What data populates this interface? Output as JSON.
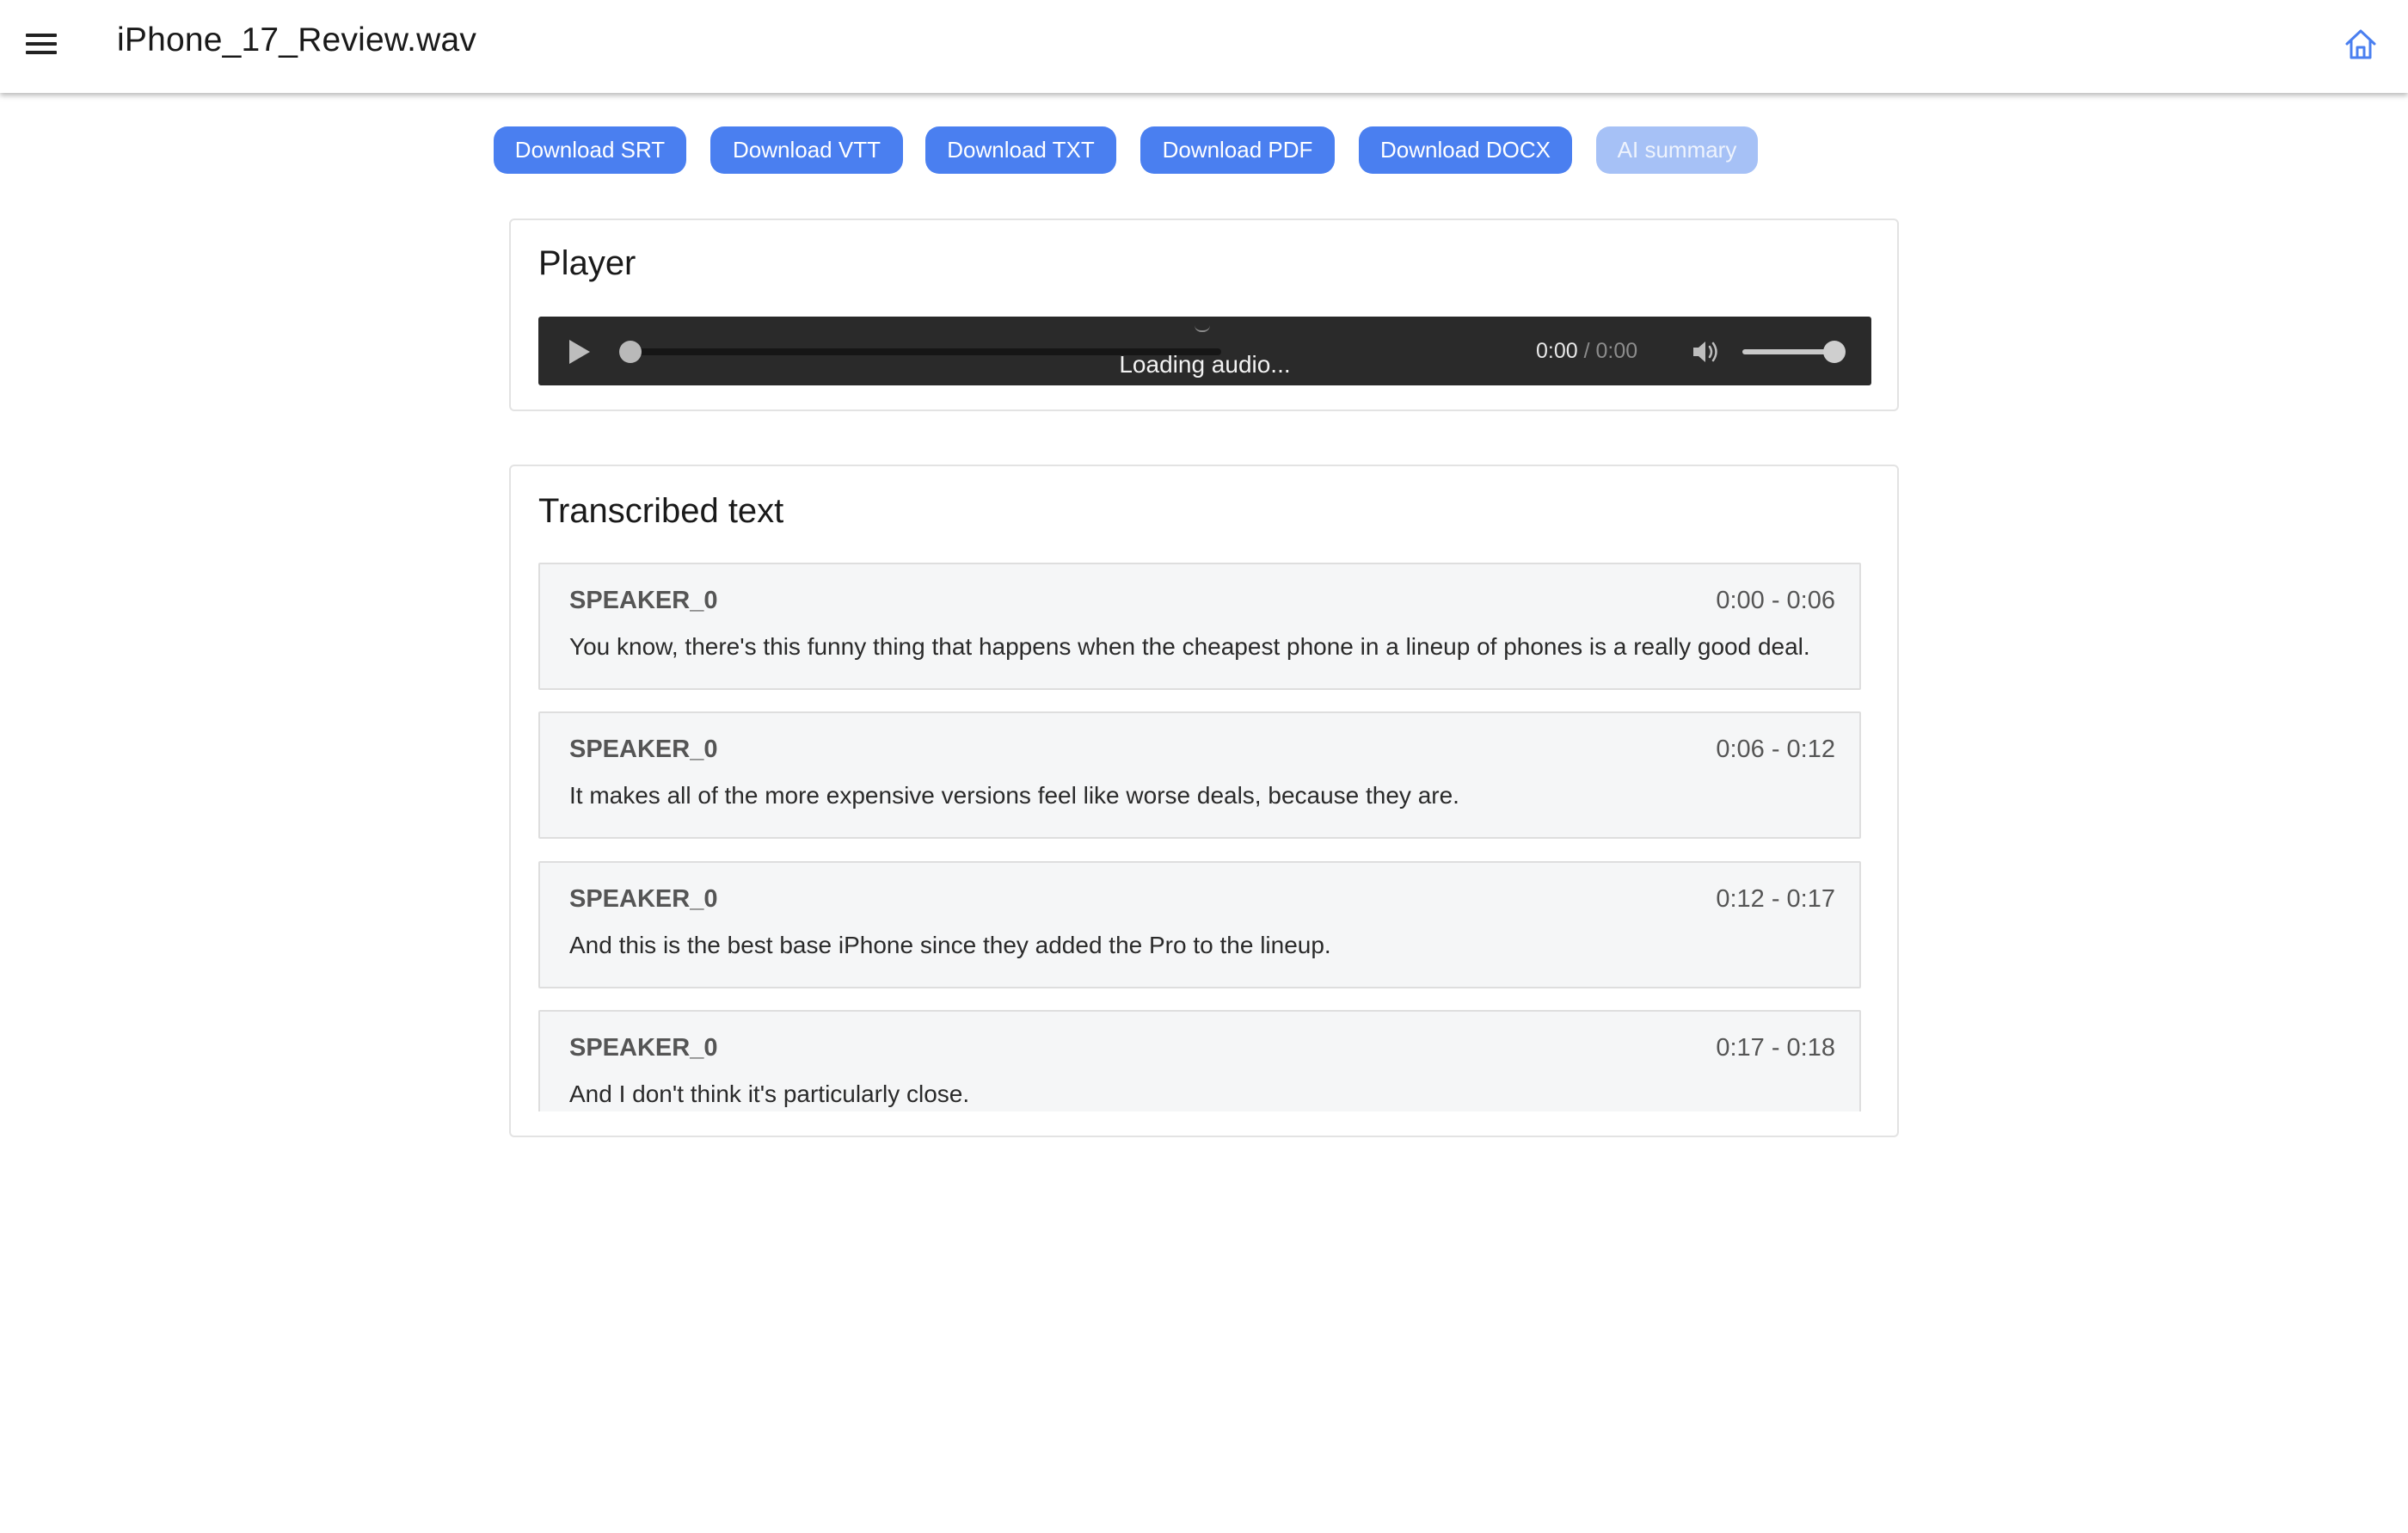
{
  "header": {
    "title": "iPhone_17_Review.wav",
    "menu_icon": "hamburger-menu-icon",
    "home_icon": "home-icon"
  },
  "toolbar": {
    "buttons": [
      {
        "label": "Download SRT",
        "enabled": true
      },
      {
        "label": "Download VTT",
        "enabled": true
      },
      {
        "label": "Download TXT",
        "enabled": true
      },
      {
        "label": "Download PDF",
        "enabled": true
      },
      {
        "label": "Download DOCX",
        "enabled": true
      },
      {
        "label": "AI summary",
        "enabled": false
      }
    ]
  },
  "player": {
    "title": "Player",
    "status": "Loading audio...",
    "current_time": "0:00",
    "separator": "/",
    "duration": "0:00",
    "progress": 0,
    "volume": 1.0
  },
  "transcript": {
    "title": "Transcribed text",
    "segments": [
      {
        "speaker": "SPEAKER_0",
        "time": "0:00 - 0:06",
        "text": "You know, there's this funny thing that happens when the cheapest phone in a lineup of phones is a really good deal."
      },
      {
        "speaker": "SPEAKER_0",
        "time": "0:06 - 0:12",
        "text": "It makes all of the more expensive versions feel like worse deals, because they are."
      },
      {
        "speaker": "SPEAKER_0",
        "time": "0:12 - 0:17",
        "text": "And this is the best base iPhone since they added the Pro to the lineup."
      },
      {
        "speaker": "SPEAKER_0",
        "time": "0:17 - 0:18",
        "text": "And I don't think it's particularly close."
      }
    ]
  },
  "colors": {
    "accent": "#4a7ff0",
    "accent_disabled": "#a6c1f6",
    "player_bg": "#2a2a2a",
    "segment_bg": "#f5f6f7"
  }
}
